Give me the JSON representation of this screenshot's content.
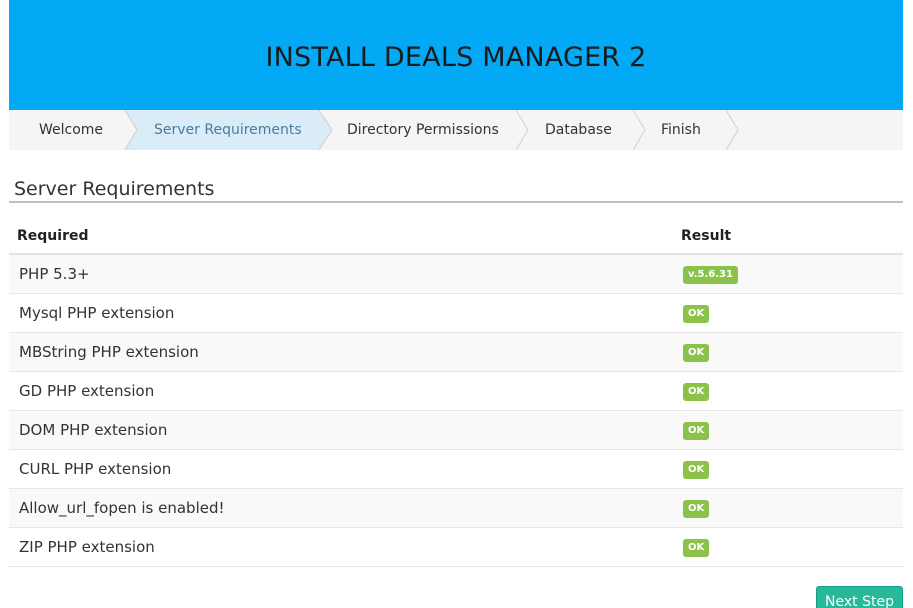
{
  "header": {
    "title": "INSTALL DEALS MANAGER 2"
  },
  "steps": [
    {
      "label": "Welcome",
      "active": false
    },
    {
      "label": "Server Requirements",
      "active": true
    },
    {
      "label": "Directory Permissions",
      "active": false
    },
    {
      "label": "Database",
      "active": false
    },
    {
      "label": "Finish",
      "active": false
    }
  ],
  "section": {
    "title": "Server Requirements"
  },
  "table": {
    "headers": [
      "Required",
      "Result"
    ],
    "rows": [
      {
        "name": "PHP 5.3+",
        "result": "v.5.6.31"
      },
      {
        "name": "Mysql PHP extension",
        "result": "OK"
      },
      {
        "name": "MBString PHP extension",
        "result": "OK"
      },
      {
        "name": "GD PHP extension",
        "result": "OK"
      },
      {
        "name": "DOM PHP extension",
        "result": "OK"
      },
      {
        "name": "CURL PHP extension",
        "result": "OK"
      },
      {
        "name": "Allow_url_fopen is enabled!",
        "result": "OK"
      },
      {
        "name": "ZIP PHP extension",
        "result": "OK"
      }
    ]
  },
  "actions": {
    "next_label": "Next Step"
  },
  "colors": {
    "header_bg": "#03a9f4",
    "active_step_bg": "#d9ecf7",
    "badge_ok": "#8bc34a",
    "button_bg": "#26b99a"
  }
}
